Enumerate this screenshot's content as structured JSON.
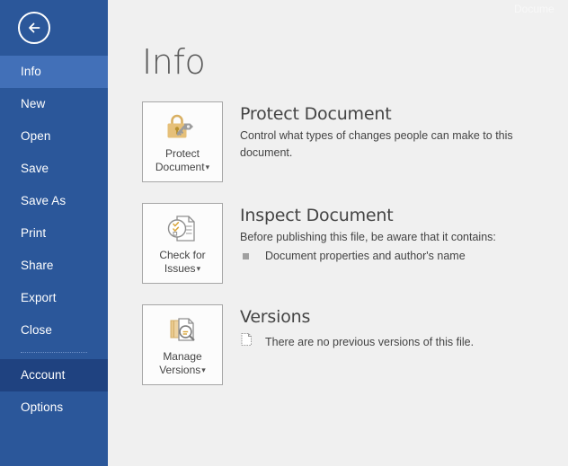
{
  "window": {
    "title_partial": "Docume"
  },
  "sidebar": {
    "back_icon": "back-arrow-icon",
    "items": [
      {
        "label": "Info",
        "state": "selected"
      },
      {
        "label": "New",
        "state": "normal"
      },
      {
        "label": "Open",
        "state": "normal"
      },
      {
        "label": "Save",
        "state": "normal"
      },
      {
        "label": "Save As",
        "state": "normal"
      },
      {
        "label": "Print",
        "state": "normal"
      },
      {
        "label": "Share",
        "state": "normal"
      },
      {
        "label": "Export",
        "state": "normal"
      },
      {
        "label": "Close",
        "state": "normal"
      },
      {
        "label": "Account",
        "state": "highlighted"
      },
      {
        "label": "Options",
        "state": "normal"
      }
    ]
  },
  "main": {
    "page_title": "Info",
    "sections": [
      {
        "tile_label": "Protect\nDocument",
        "tile_icon": "padlock-key-icon",
        "heading": "Protect Document",
        "description": "Control what types of changes people can make to this document."
      },
      {
        "tile_label": "Check for\nIssues",
        "tile_icon": "document-inspect-icon",
        "heading": "Inspect Document",
        "description": "Before publishing this file, be aware that it contains:",
        "bullet": "Document properties and author's name"
      },
      {
        "tile_label": "Manage\nVersions",
        "tile_icon": "document-stack-search-icon",
        "heading": "Versions",
        "version_note": "There are no previous versions of this file."
      }
    ]
  },
  "colors": {
    "sidebar_blue": "#2b579a",
    "sidebar_selected": "#4270b8",
    "sidebar_account": "#1f4280",
    "content_bg": "#f0f0f0",
    "tile_bg": "#fcfcfc",
    "tile_border": "#a6a6a6",
    "accent_gold": "#e3bc6d",
    "text_gray": "#444444"
  }
}
